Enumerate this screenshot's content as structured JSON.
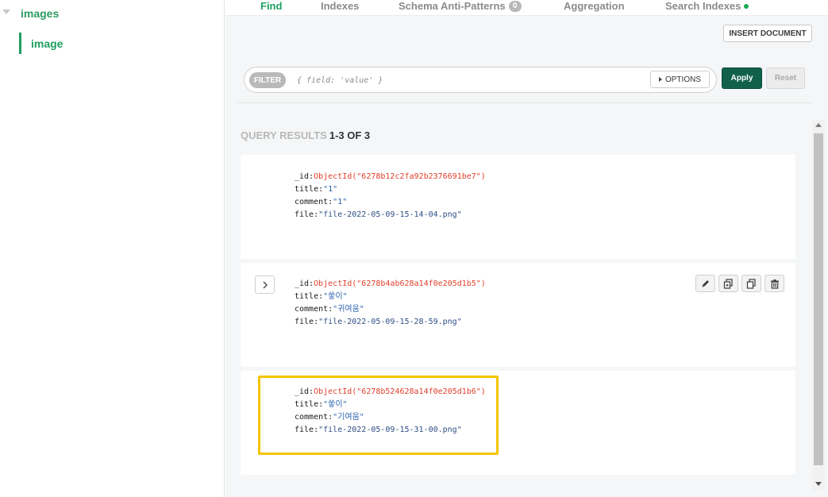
{
  "sidebar": {
    "database": "images",
    "collection": "image"
  },
  "tabs": [
    {
      "label": "Find"
    },
    {
      "label": "Indexes"
    },
    {
      "label": "Schema Anti-Patterns",
      "badge": "0"
    },
    {
      "label": "Aggregation"
    },
    {
      "label": "Search Indexes"
    }
  ],
  "toolbar": {
    "insert_label": "INSERT DOCUMENT",
    "filter_label": "FILTER",
    "filter_placeholder": "{ field: 'value' }",
    "options_label": "OPTIONS",
    "apply_label": "Apply",
    "reset_label": "Reset"
  },
  "results": {
    "label": "QUERY RESULTS",
    "count": "1-3 OF 3"
  },
  "documents": [
    {
      "id_key": "_id:",
      "id_val": "ObjectId(\"6278b12c2fa92b2376691be7\")",
      "title_key": "title:",
      "title_val": "\"1\"",
      "comment_key": "comment:",
      "comment_val": "\"1\"",
      "file_key": "file:",
      "file_val": "\"file-2022-05-09-15-14-04.png\""
    },
    {
      "id_key": "_id:",
      "id_val": "ObjectId(\"6278b4ab628a14f0e205d1b5\")",
      "title_key": "title:",
      "title_val": "\"쑿이\"",
      "comment_key": "comment:",
      "comment_val": "\"귀여움\"",
      "file_key": "file:",
      "file_val": "\"file-2022-05-09-15-28-59.png\""
    },
    {
      "id_key": "_id:",
      "id_val": "ObjectId(\"6278b524628a14f0e205d1b6\")",
      "title_key": "title:",
      "title_val": "\"쑿이\"",
      "comment_key": "comment:",
      "comment_val": "\"기여움\"",
      "file_key": "file:",
      "file_val": "\"file-2022-05-09-15-31-00.png\""
    }
  ],
  "colors": {
    "accent_green": "#1e9f60",
    "apply_bg": "#116149",
    "objectid_red": "#e03f2a",
    "string_blue": "#2b63b0",
    "highlight_yellow": "#f5c400"
  },
  "icons": [
    "caret-down-icon",
    "caret-right-icon",
    "chevron-right-icon",
    "pencil-icon",
    "clone-icon",
    "copy-icon",
    "trash-icon"
  ]
}
